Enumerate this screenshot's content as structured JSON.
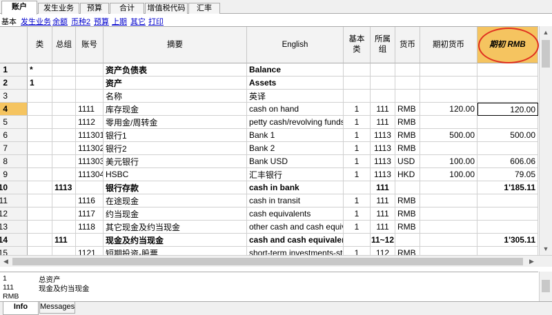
{
  "tabs": [
    {
      "label": "账户",
      "active": true
    },
    {
      "label": "发生业务",
      "active": false
    },
    {
      "label": "预算",
      "active": false
    },
    {
      "label": "合计",
      "active": false
    },
    {
      "label": "增值税代码",
      "active": false
    },
    {
      "label": "汇率",
      "active": false
    }
  ],
  "subtabs": [
    {
      "label": "基本",
      "active": true
    },
    {
      "label": "发生业务",
      "active": false
    },
    {
      "label": "余额",
      "active": false
    },
    {
      "label": "币种2",
      "active": false
    },
    {
      "label": "预算",
      "active": false
    },
    {
      "label": "上期",
      "active": false
    },
    {
      "label": "其它",
      "active": false
    },
    {
      "label": "打印",
      "active": false
    }
  ],
  "columns": {
    "section": "类",
    "group": "总组",
    "account": "账号",
    "description": "摘要",
    "english": "English",
    "bclass": "基本类",
    "gr": "所属组",
    "currency": "货币",
    "opening_currency": "期初货币",
    "opening_rmb": "期初 RMB"
  },
  "rows": [
    {
      "n": "1",
      "section": "*",
      "group": "",
      "account": "",
      "description": "资产负债表",
      "english": "Balance",
      "bclass": "",
      "gr": "",
      "currency": "",
      "opening_currency": "",
      "opening_rmb": "",
      "bold": true
    },
    {
      "n": "2",
      "section": "1",
      "group": "",
      "account": "",
      "description": "资产",
      "english": "Assets",
      "bclass": "",
      "gr": "",
      "currency": "",
      "opening_currency": "",
      "opening_rmb": "",
      "bold": true
    },
    {
      "n": "3",
      "section": "",
      "group": "",
      "account": "",
      "description": "名称",
      "english": "英译",
      "bclass": "",
      "gr": "",
      "currency": "",
      "opening_currency": "",
      "opening_rmb": "",
      "bold": false
    },
    {
      "n": "4",
      "section": "",
      "group": "",
      "account": "1111",
      "description": "库存现金",
      "english": "cash on hand",
      "bclass": "1",
      "gr": "111",
      "currency": "RMB",
      "opening_currency": "120.00",
      "opening_rmb": "120.00",
      "bold": false,
      "current": true
    },
    {
      "n": "5",
      "section": "",
      "group": "",
      "account": "1112",
      "description": "零用金/周转金",
      "english": "petty cash/revolving funds",
      "bclass": "1",
      "gr": "111",
      "currency": "RMB",
      "opening_currency": "",
      "opening_rmb": "",
      "bold": false
    },
    {
      "n": "6",
      "section": "",
      "group": "",
      "account": "111301",
      "description": "银行1",
      "english": "Bank 1",
      "bclass": "1",
      "gr": "1113",
      "currency": "RMB",
      "opening_currency": "500.00",
      "opening_rmb": "500.00",
      "bold": false
    },
    {
      "n": "7",
      "section": "",
      "group": "",
      "account": "111302",
      "description": "银行2",
      "english": "Bank 2",
      "bclass": "1",
      "gr": "1113",
      "currency": "RMB",
      "opening_currency": "",
      "opening_rmb": "",
      "bold": false
    },
    {
      "n": "8",
      "section": "",
      "group": "",
      "account": "111303",
      "description": "美元银行",
      "english": "Bank USD",
      "bclass": "1",
      "gr": "1113",
      "currency": "USD",
      "opening_currency": "100.00",
      "opening_rmb": "606.06",
      "bold": false
    },
    {
      "n": "9",
      "section": "",
      "group": "",
      "account": "111304",
      "description": "HSBC",
      "english": "汇丰银行",
      "bclass": "1",
      "gr": "1113",
      "currency": "HKD",
      "opening_currency": "100.00",
      "opening_rmb": "79.05",
      "bold": false
    },
    {
      "n": "10",
      "section": "",
      "group": "1113",
      "account": "",
      "description": "银行存款",
      "english": "cash in bank",
      "bclass": "",
      "gr": "111",
      "currency": "",
      "opening_currency": "",
      "opening_rmb": "1'185.11",
      "bold": true
    },
    {
      "n": "11",
      "section": "",
      "group": "",
      "account": "1116",
      "description": "在途现金",
      "english": "cash in transit",
      "bclass": "1",
      "gr": "111",
      "currency": "RMB",
      "opening_currency": "",
      "opening_rmb": "",
      "bold": false
    },
    {
      "n": "12",
      "section": "",
      "group": "",
      "account": "1117",
      "description": "约当现金",
      "english": "cash equivalents",
      "bclass": "1",
      "gr": "111",
      "currency": "RMB",
      "opening_currency": "",
      "opening_rmb": "",
      "bold": false
    },
    {
      "n": "13",
      "section": "",
      "group": "",
      "account": "1118",
      "description": "其它现金及约当现金",
      "english": "other cash and cash equivalents",
      "bclass": "1",
      "gr": "111",
      "currency": "RMB",
      "opening_currency": "",
      "opening_rmb": "",
      "bold": false
    },
    {
      "n": "14",
      "section": "",
      "group": "111",
      "account": "",
      "description": "现金及约当现金",
      "english": "cash and cash equivalents",
      "bclass": "",
      "gr": "11~12",
      "currency": "",
      "opening_currency": "",
      "opening_rmb": "1'305.11",
      "bold": true
    },
    {
      "n": "15",
      "section": "",
      "group": "",
      "account": "1121",
      "description": "短期投资-股票",
      "english": "short-term investments-stock",
      "bclass": "1",
      "gr": "112",
      "currency": "RMB",
      "opening_currency": "",
      "opening_rmb": "",
      "bold": false
    }
  ],
  "info": [
    {
      "key": "1",
      "value": "总资产"
    },
    {
      "key": "111",
      "value": "现金及约当现金"
    },
    {
      "key": "RMB",
      "value": ""
    }
  ],
  "bottom_tabs": [
    {
      "label": "Info",
      "active": true
    },
    {
      "label": "Messages",
      "active": false
    }
  ],
  "colors": {
    "opening_header": "#f5c460",
    "highlight_circle": "#e03020",
    "link": "#0000cc"
  },
  "icons": {
    "scroll_up": "triangle-up-icon",
    "scroll_down": "triangle-down-icon",
    "scroll_left": "triangle-left-icon",
    "scroll_right": "triangle-right-icon"
  }
}
